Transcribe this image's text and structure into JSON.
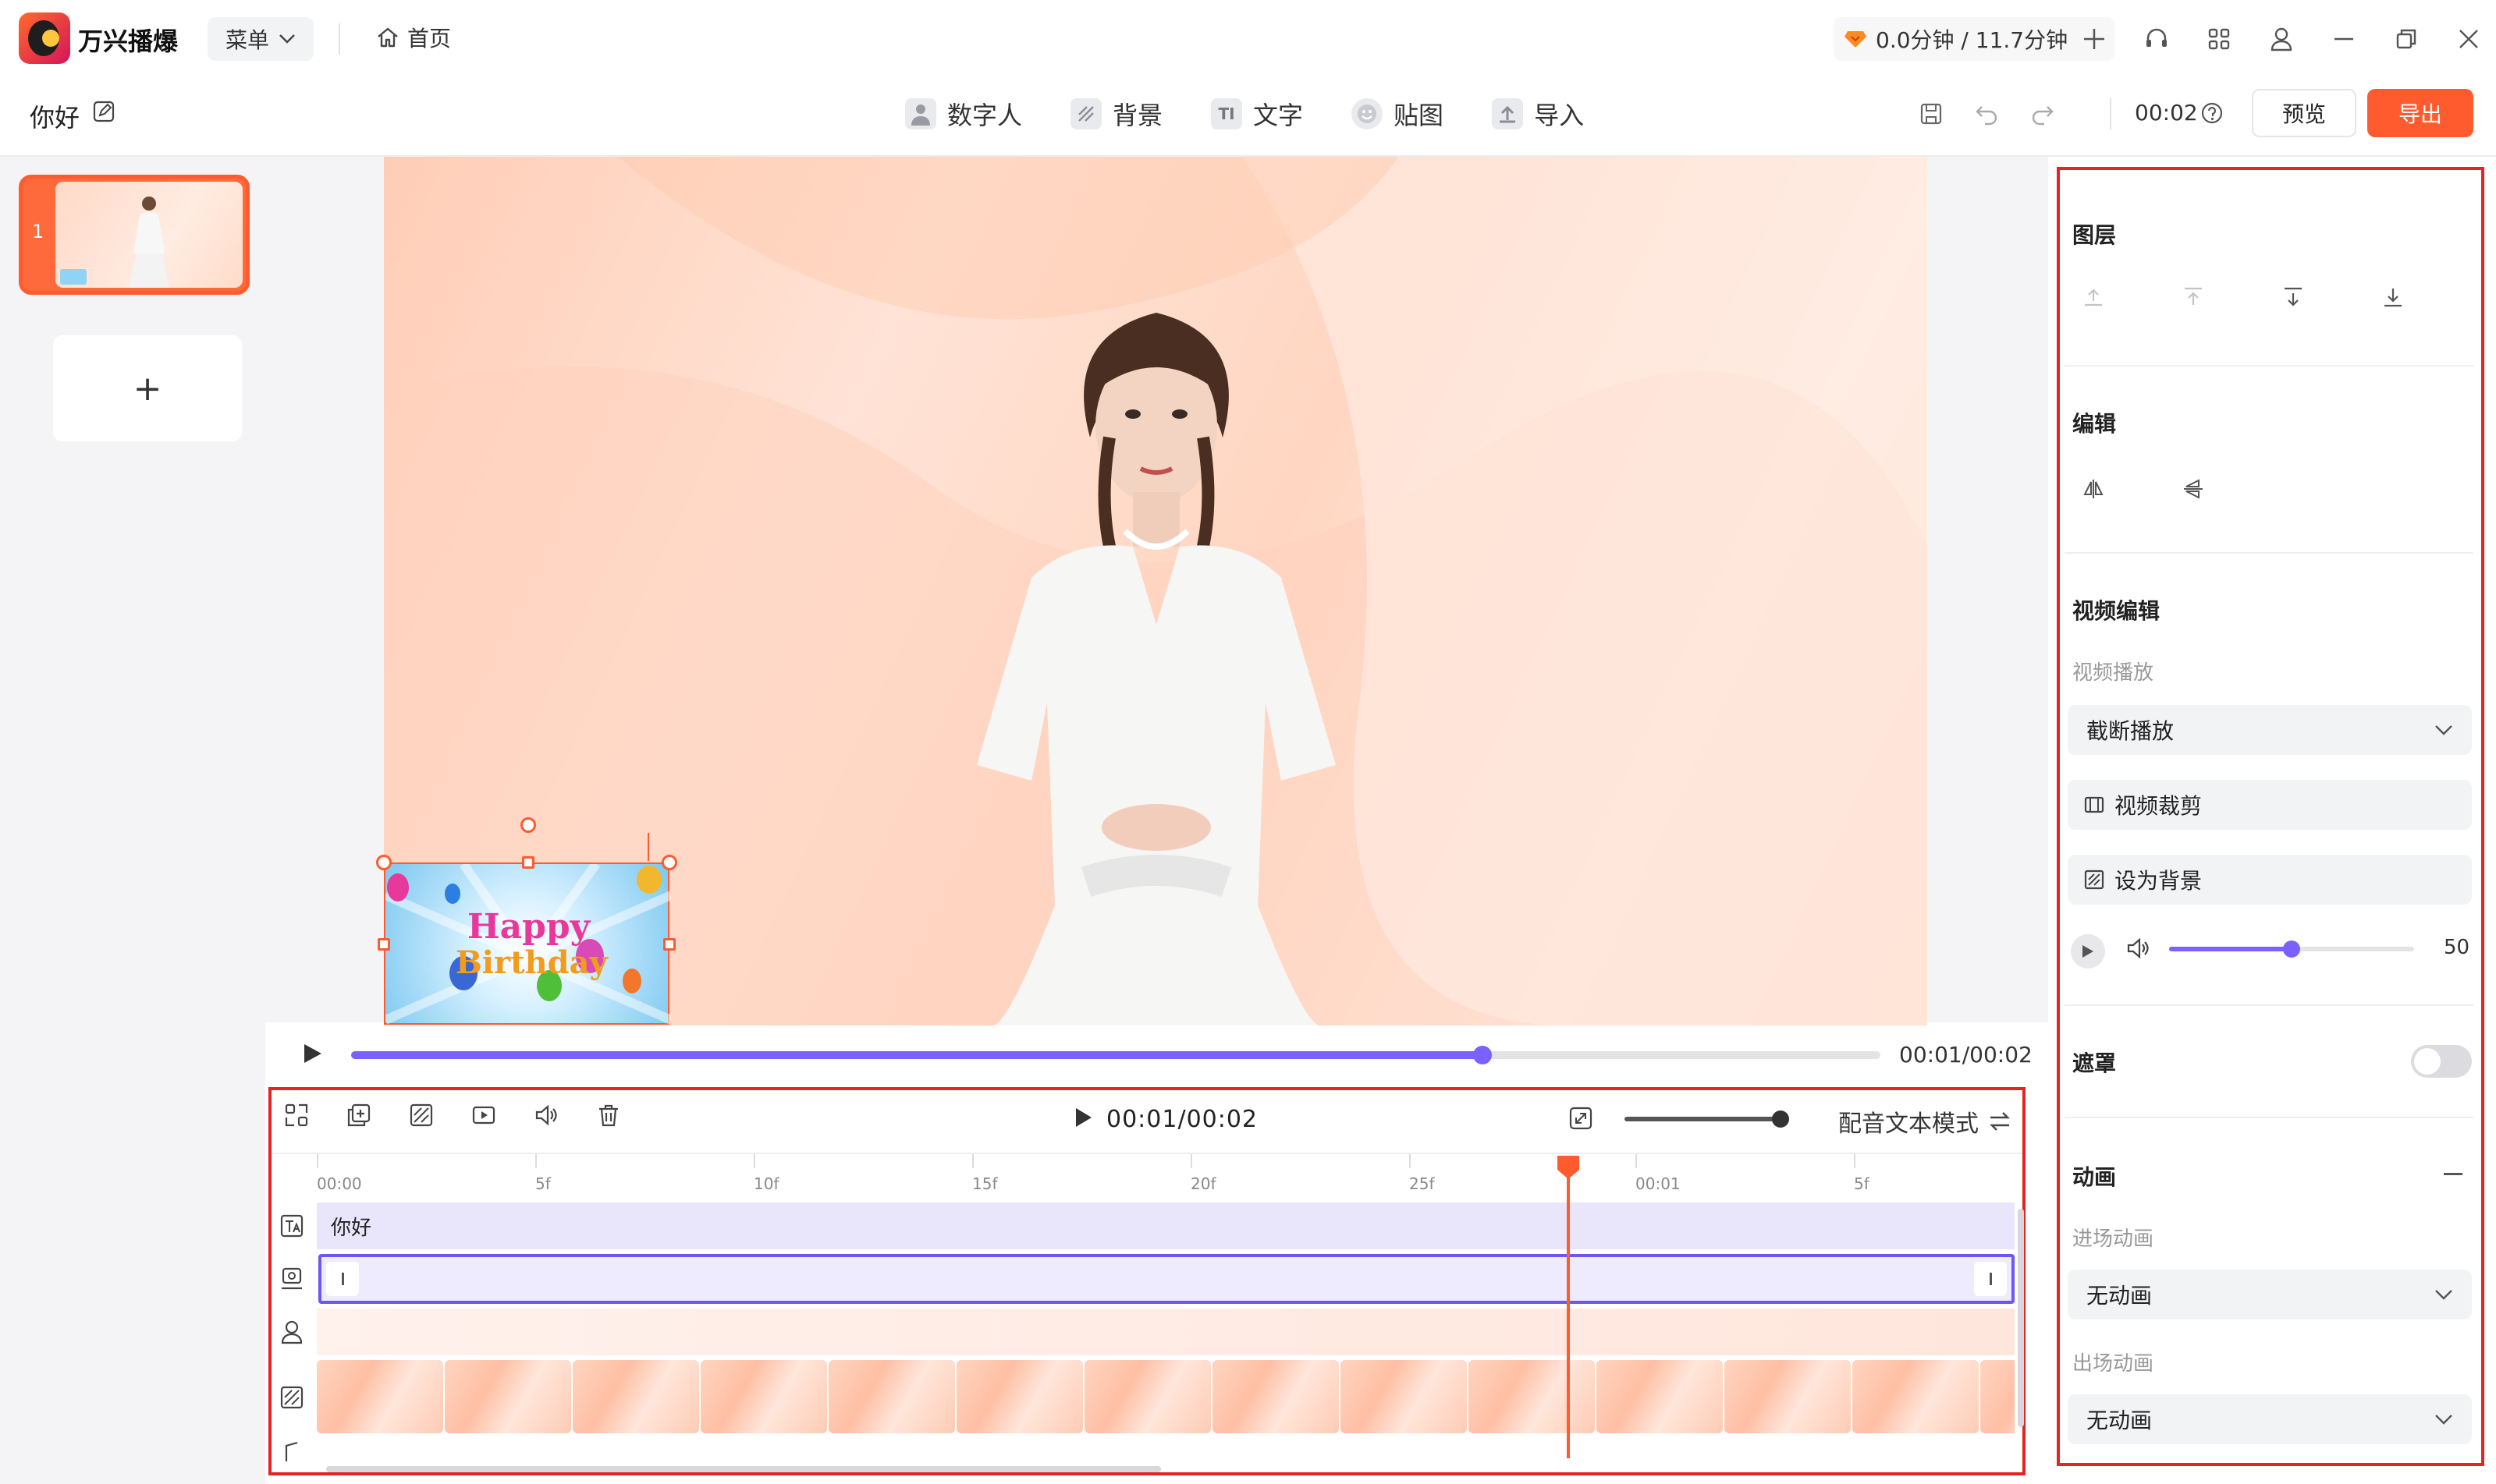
{
  "app": {
    "name": "万兴播爆",
    "menu_label": "菜单",
    "home_label": "首页",
    "quota_text": "0.0分钟 / 11.7分钟"
  },
  "project": {
    "title": "你好",
    "time_display": "00:02",
    "preview_label": "预览",
    "export_label": "导出"
  },
  "toolbar": {
    "tools": [
      {
        "label": "数字人",
        "icon": "digital-human-icon"
      },
      {
        "label": "背景",
        "icon": "background-icon"
      },
      {
        "label": "文字",
        "icon": "text-icon",
        "glyph": "TI"
      },
      {
        "label": "贴图",
        "icon": "sticker-icon"
      },
      {
        "label": "导入",
        "icon": "import-icon"
      }
    ]
  },
  "scenes": {
    "items": [
      {
        "number": "1"
      }
    ],
    "add_label": "+"
  },
  "sticker": {
    "line1": "Happy",
    "line2": "Birthday"
  },
  "player": {
    "time": "00:01/00:02",
    "progress": 0.74
  },
  "timeline": {
    "time": "00:01/00:02",
    "dub_mode_label": "配音文本模式",
    "zoom_level": 0.9,
    "ruler_labels": [
      "00:00",
      "5f",
      "10f",
      "15f",
      "20f",
      "25f",
      "00:01",
      "5f"
    ],
    "text_track_label": "你好"
  },
  "right_panel": {
    "layer_title": "图层",
    "edit_title": "编辑",
    "video_edit_title": "视频编辑",
    "video_play_label": "视频播放",
    "video_play_value": "截断播放",
    "crop_label": "视频裁剪",
    "set_bg_label": "设为背景",
    "volume_value": "50",
    "volume_level": 0.5,
    "mask_title": "遮罩",
    "mask_on": false,
    "animation_title": "动画",
    "enter_anim_label": "进场动画",
    "enter_anim_value": "无动画",
    "exit_anim_label": "出场动画",
    "exit_anim_value": "无动画"
  },
  "colors": {
    "accent": "#ff5b2e",
    "progress": "#7b61ff",
    "highlight_border": "#e62222"
  }
}
